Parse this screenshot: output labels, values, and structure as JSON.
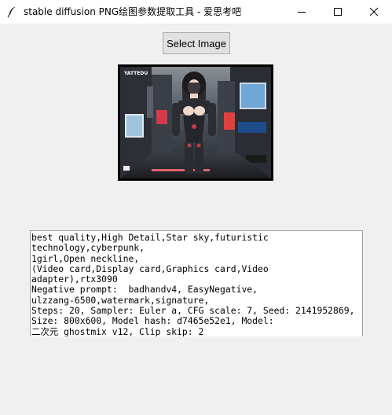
{
  "window": {
    "title": "stable diffusion PNG绘图参数提取工具 - 爱思考吧",
    "icon": "feather-icon"
  },
  "toolbar": {
    "select_label": "Select Image"
  },
  "preview": {
    "image_badge": "YATTEDU"
  },
  "output": {
    "text": "best quality,High Detail,Star sky,futuristic\ntechnology,cyberpunk,\n1girl,Open neckline,\n(Video card,Display card,Graphics card,Video\nadapter),rtx3090\nNegative prompt:  badhandv4, EasyNegative,\nulzzang-6500,watermark,signature,\nSteps: 20, Sampler: Euler a, CFG scale: 7, Seed: 2141952869,\nSize: 800x600, Model hash: d7465e52e1, Model:\n二次元_ghostmix_v12, Clip skip: 2"
  }
}
